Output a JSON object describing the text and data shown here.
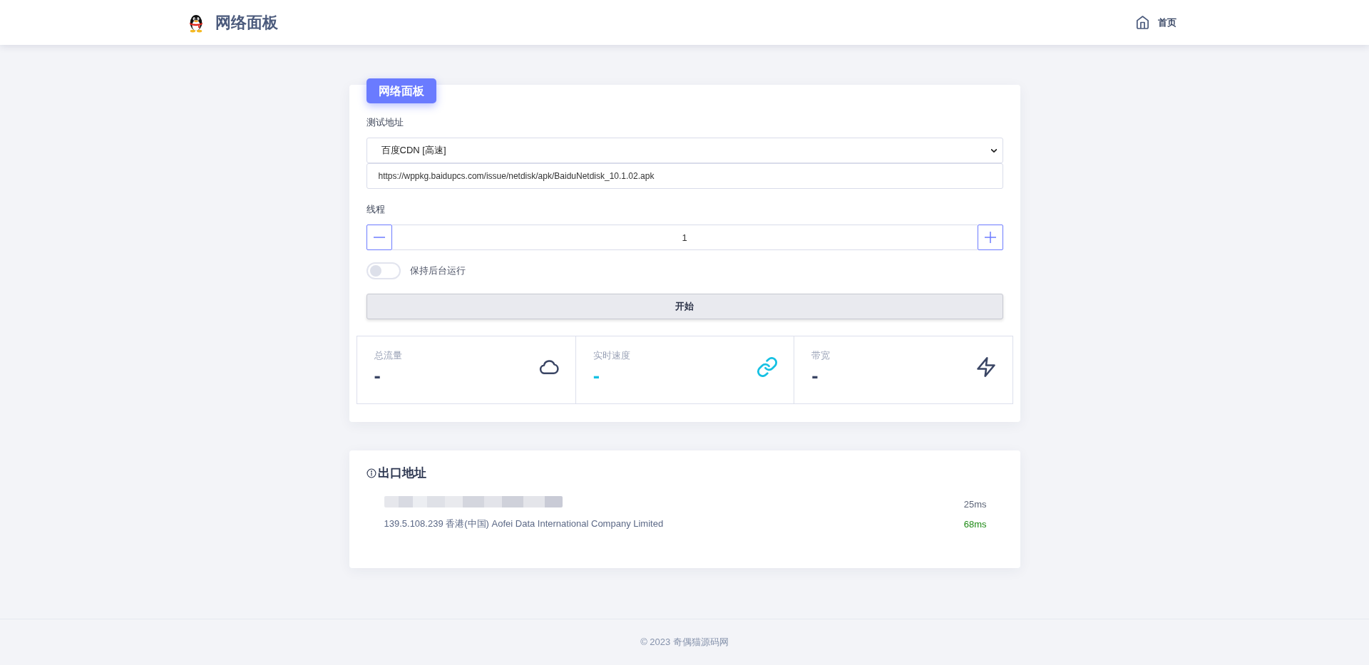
{
  "header": {
    "title": "网络面板",
    "nav": [
      {
        "label": "首页"
      }
    ]
  },
  "panel": {
    "badge": "网络面板",
    "test_address": {
      "label": "测试地址",
      "selected_option": "百度CDN [高速]",
      "url": "https://wppkg.baidupcs.com/issue/netdisk/apk/BaiduNetdisk_10.1.02.apk"
    },
    "threads": {
      "label": "线程",
      "value": "1"
    },
    "background_run": {
      "label": "保持后台运行",
      "on": false
    },
    "start_button": "开始",
    "stats": [
      {
        "label": "总流量",
        "value": "-",
        "color": "#3a4564"
      },
      {
        "label": "实时速度",
        "value": "-",
        "color": "#16c1e3"
      },
      {
        "label": "带宽",
        "value": "-",
        "color": "#3a4564"
      }
    ]
  },
  "exit_address": {
    "title": "出口地址",
    "rows": [
      {
        "redacted": true,
        "latency": "25ms",
        "color": "#5d6578"
      },
      {
        "redacted": false,
        "address": "139.5.108.239 香港(中国) Aofei Data International Company Limited",
        "latency": "68ms",
        "color": "#1d8a14"
      }
    ]
  },
  "footer": {
    "text": "© 2023 奇偶猫源码网"
  }
}
